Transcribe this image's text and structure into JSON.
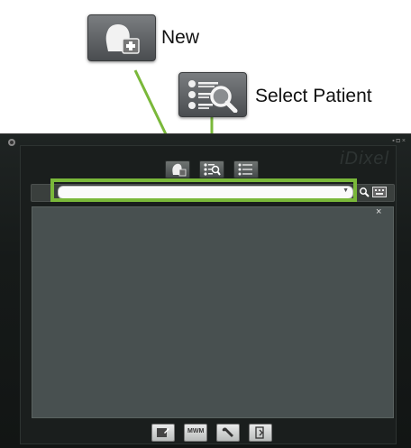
{
  "callouts": {
    "new": {
      "label": "New",
      "icon": "new-patient-icon"
    },
    "select_patient": {
      "label": "Select Patient",
      "icon": "select-patient-icon"
    }
  },
  "app": {
    "brand": "iDixel",
    "search": {
      "value": "",
      "placeholder": ""
    },
    "toolbar_icons": [
      "new-patient-icon",
      "select-patient-icon",
      "patient-list-icon"
    ],
    "bottom_icons": [
      "edit-icon",
      "mwm-icon",
      "wrench-icon",
      "exit-icon"
    ],
    "mwm_label": "MWM",
    "close_glyph": "×"
  },
  "colors": {
    "highlight": "#7ab83a",
    "panel": "#485050",
    "window": "#161a19"
  }
}
